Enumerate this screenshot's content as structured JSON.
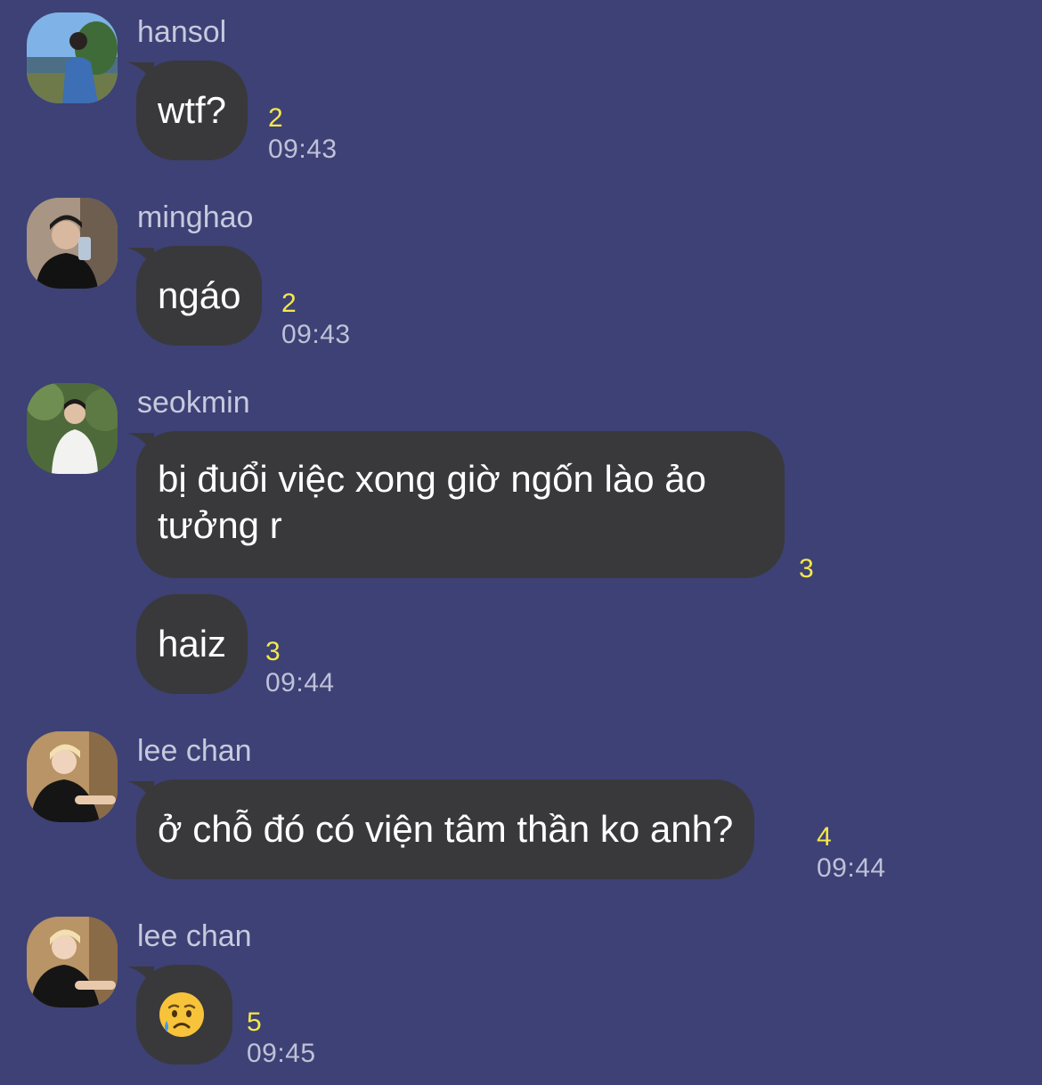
{
  "messages": [
    {
      "sender": "hansol",
      "text": "wtf?",
      "read_count": "2",
      "time": "09:43"
    },
    {
      "sender": "minghao",
      "text": "ngáo",
      "read_count": "2",
      "time": "09:43"
    },
    {
      "sender": "seokmin",
      "text": "bị đuổi việc xong giờ ngốn lào ảo tưởng r",
      "read_count": "3"
    },
    {
      "text": "haiz",
      "read_count": "3",
      "time": "09:44"
    },
    {
      "sender": "lee chan",
      "text": "ở chỗ đó có viện tâm thần ko anh?",
      "read_count": "4",
      "time": "09:44"
    },
    {
      "sender": "lee chan",
      "emoji": "sad-but-relieved-face",
      "read_count": "5",
      "time": "09:45"
    }
  ],
  "colors": {
    "background": "#3d4175",
    "bubble": "#39393b",
    "read_count": "#f5e84a",
    "time": "#bfc1d8",
    "sender_name": "#c7c9de"
  }
}
